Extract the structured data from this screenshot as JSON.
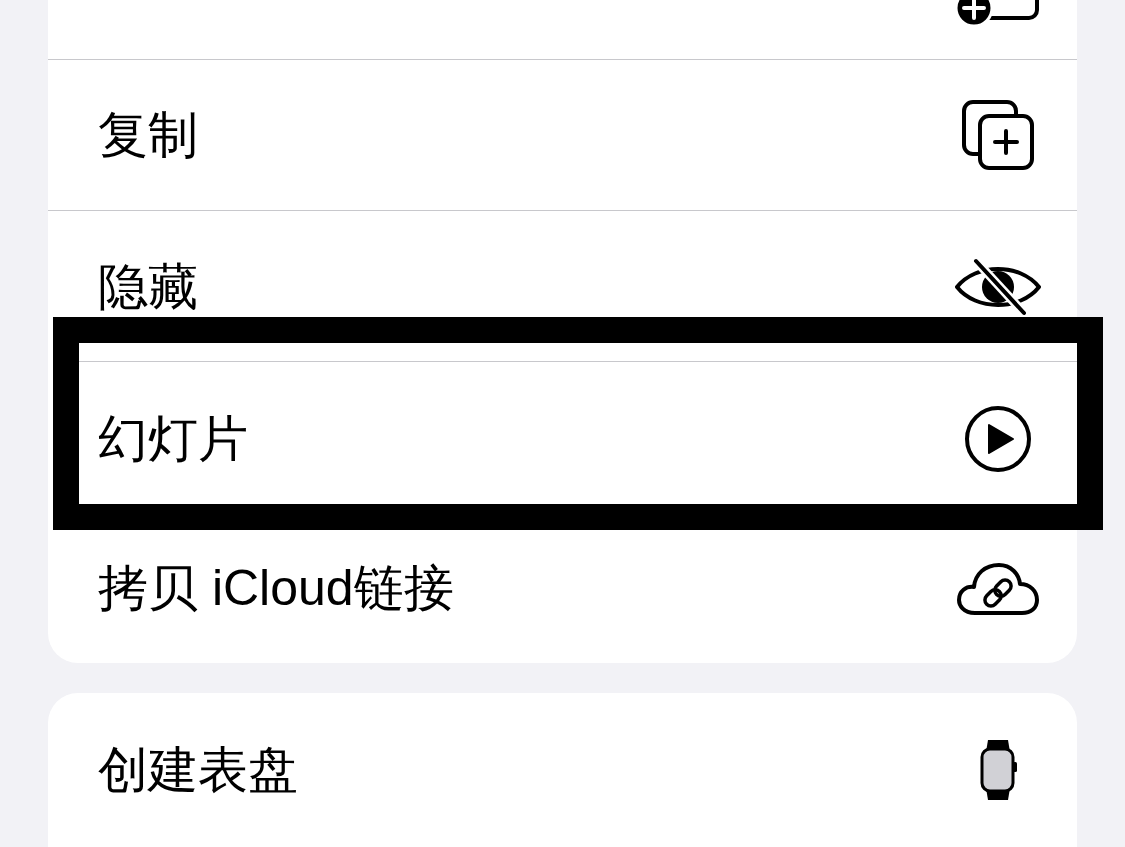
{
  "menu_groups": [
    {
      "items": [
        {
          "highlighted": false
        },
        {
          "label": "复制",
          "highlighted": false
        },
        {
          "label": "隐藏",
          "highlighted": false
        },
        {
          "label": "幻灯片",
          "highlighted": true
        },
        {
          "label": "拷贝 iCloud链接",
          "highlighted": false
        }
      ]
    },
    {
      "items": [
        {
          "label": "创建表盘",
          "highlighted": false
        }
      ]
    }
  ]
}
